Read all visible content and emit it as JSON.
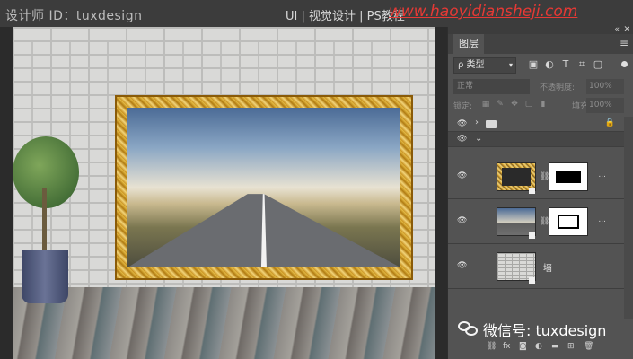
{
  "watermark": {
    "designer": "设计师 ID：tuxdesign",
    "category": "UI | 视觉设计 | PS教程",
    "url": "www.haoyidiansheji.com"
  },
  "panel": {
    "tab_label": "图层",
    "filter": {
      "kind_label": "ρ 类型"
    },
    "blend": {
      "mode": "正常",
      "opacity_label": "不透明度:",
      "opacity_value": "100%"
    },
    "lock": {
      "label": "锁定:",
      "fill_label": "填充:",
      "fill_value": "100%"
    },
    "layers": [
      {
        "type": "group"
      },
      {
        "type": "group-open"
      },
      {
        "thumb": "frame",
        "has_mask": true,
        "more": "..."
      },
      {
        "thumb": "photo",
        "has_mask": true,
        "more": "..."
      },
      {
        "thumb": "wall",
        "name": "墙"
      }
    ]
  },
  "wechat": {
    "text": "微信号: tuxdesign"
  },
  "icons": {
    "eye": "eye-icon",
    "folder": "folder-icon",
    "lock": "lock-icon",
    "link": "chain-link-icon",
    "menu": "hamburger-menu-icon"
  }
}
